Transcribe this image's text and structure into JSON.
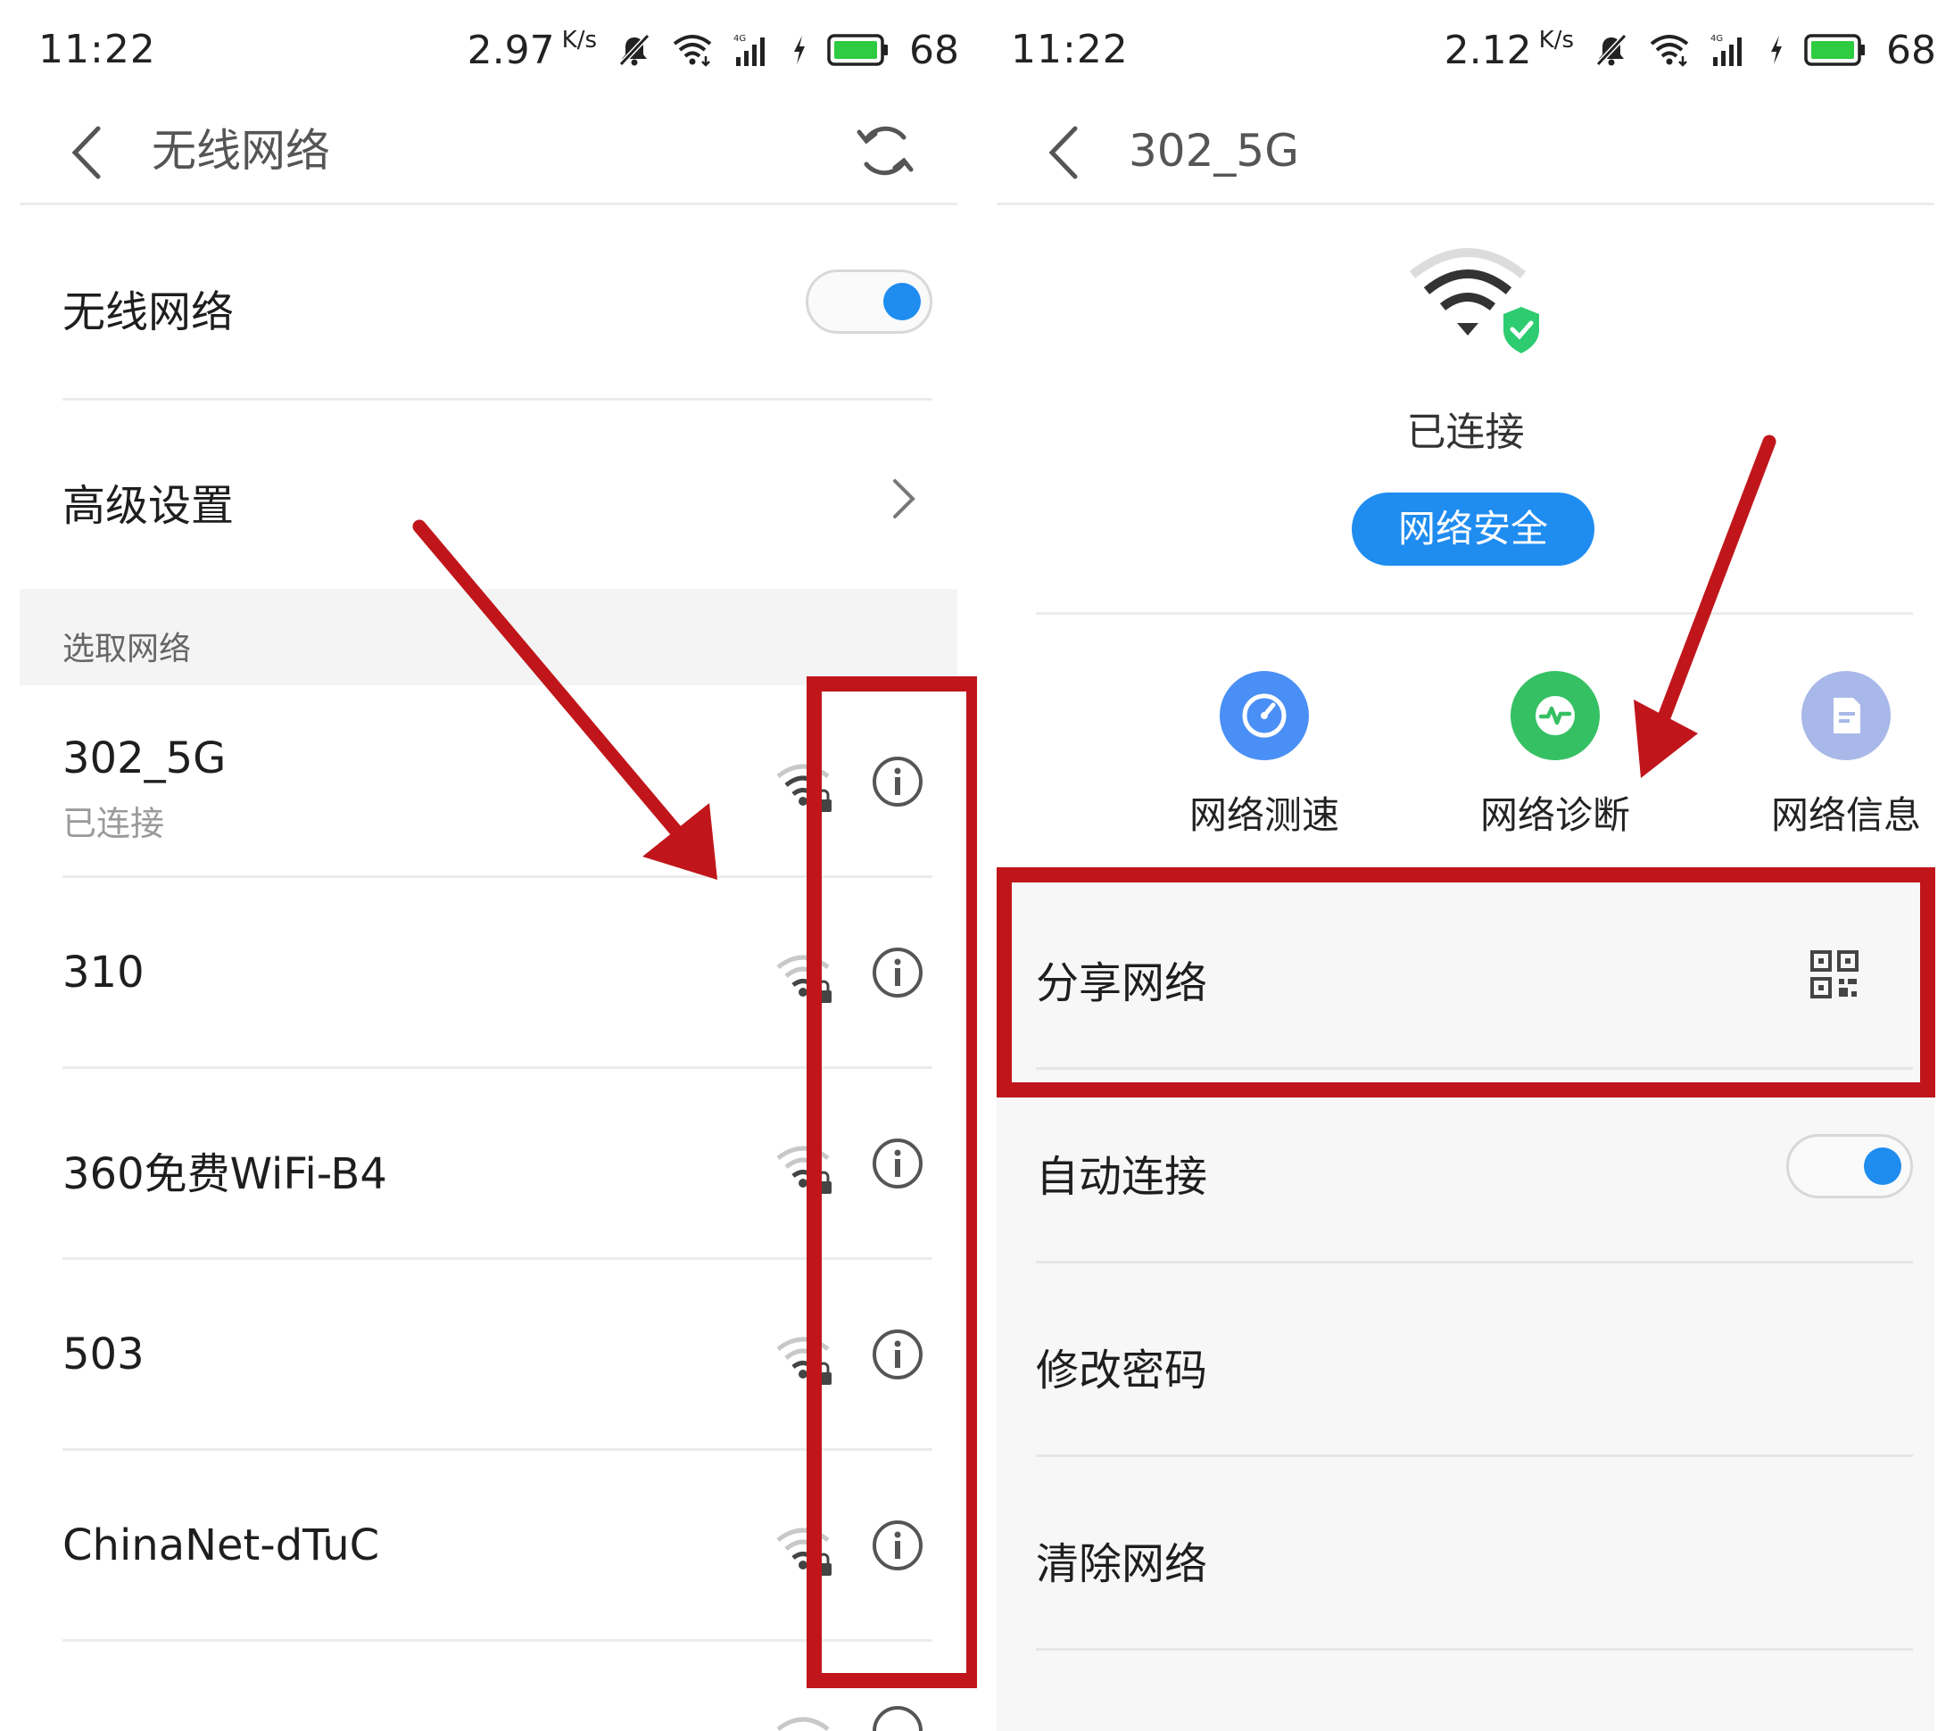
{
  "left": {
    "status_bar": {
      "time": "11:22",
      "speed": "2.97",
      "speed_unit": "K/s",
      "battery": "68"
    },
    "title": "无线网络",
    "wifi_toggle_label": "无线网络",
    "wifi_enabled": true,
    "advanced_label": "高级设置",
    "section_label": "选取网络",
    "networks": [
      {
        "name": "302_5G",
        "status": "已连接"
      },
      {
        "name": "310",
        "status": ""
      },
      {
        "name": "360免费WiFi-B4",
        "status": ""
      },
      {
        "name": "503",
        "status": ""
      },
      {
        "name": "ChinaNet-dTuC",
        "status": ""
      }
    ]
  },
  "right": {
    "status_bar": {
      "time": "11:22",
      "speed": "2.12",
      "speed_unit": "K/s",
      "battery": "68"
    },
    "title": "302_5G",
    "connection_status": "已连接",
    "security_button": "网络安全",
    "actions": [
      {
        "label": "网络测速",
        "icon": "speedometer-icon",
        "color": "#4a8ff5"
      },
      {
        "label": "网络诊断",
        "icon": "pulse-icon",
        "color": "#35c063"
      },
      {
        "label": "网络信息",
        "icon": "document-icon",
        "color": "#a8b8e8"
      }
    ],
    "settings": [
      {
        "label": "分享网络"
      },
      {
        "label": "自动连接"
      },
      {
        "label": "修改密码"
      },
      {
        "label": "清除网络"
      }
    ],
    "auto_connect_enabled": true
  },
  "colors": {
    "accent": "#1f8cf0",
    "annotation_red": "#c0161b",
    "battery_green": "#2ecc40"
  }
}
